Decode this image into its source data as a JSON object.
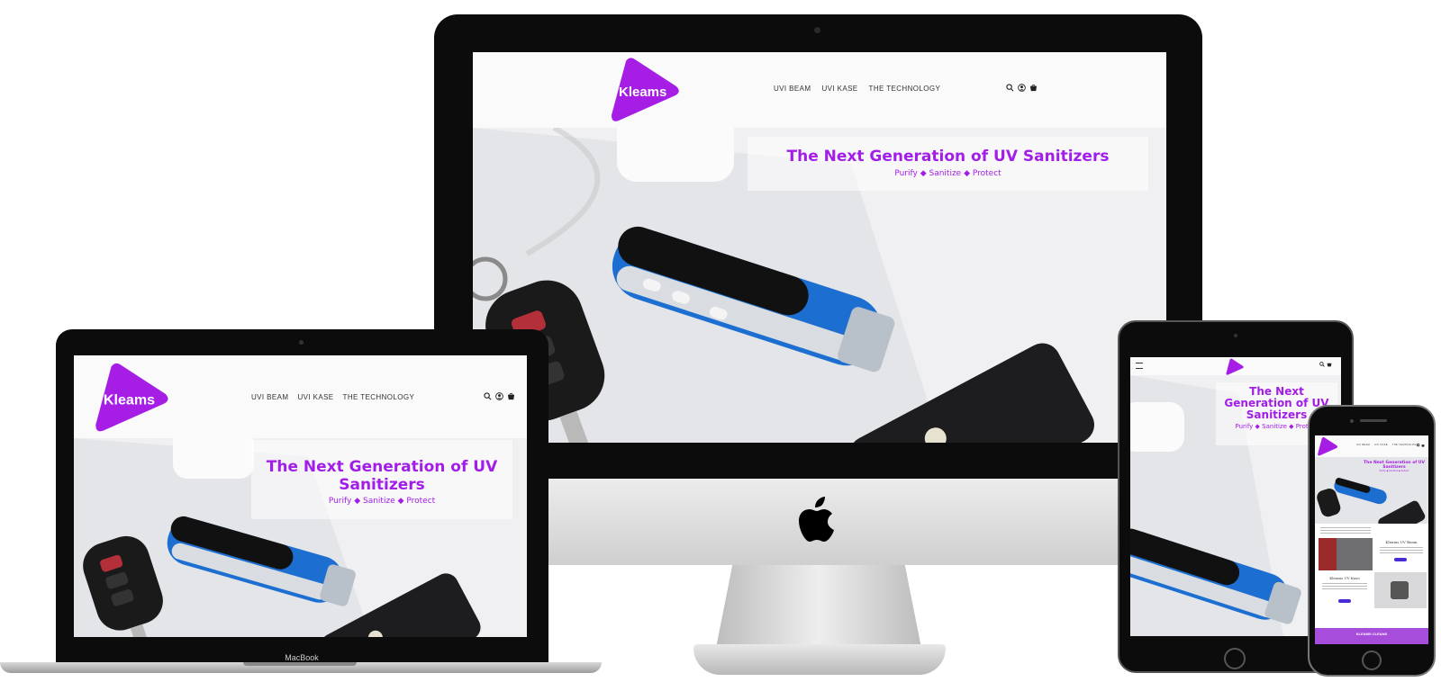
{
  "brand": {
    "name": "Kleams",
    "accent": "#a31de8",
    "logo_color": "#a61ee6"
  },
  "nav": {
    "items": [
      "UVI BEAM",
      "UVI KASE",
      "THE TECHNOLOGY"
    ]
  },
  "header_icons": [
    "search-icon",
    "account-icon",
    "cart-icon"
  ],
  "hero": {
    "title": "The Next Generation of UV Sanitizers",
    "title_line1": "The Next Generation of UV",
    "title_line2": "Sanitizers",
    "tablet_title": [
      "The Next",
      "Generation of UV",
      "Sanitizers"
    ],
    "subtitle": "Purify ◆ Sanitize ◆ Protect"
  },
  "devices": {
    "laptop_label": "MacBook"
  },
  "mobile": {
    "beam_heading": "Kleams UV Beam",
    "kase_heading": "Kleams UV Kase",
    "button_label": "",
    "banner_title": "KLEAMS CLEANS"
  }
}
